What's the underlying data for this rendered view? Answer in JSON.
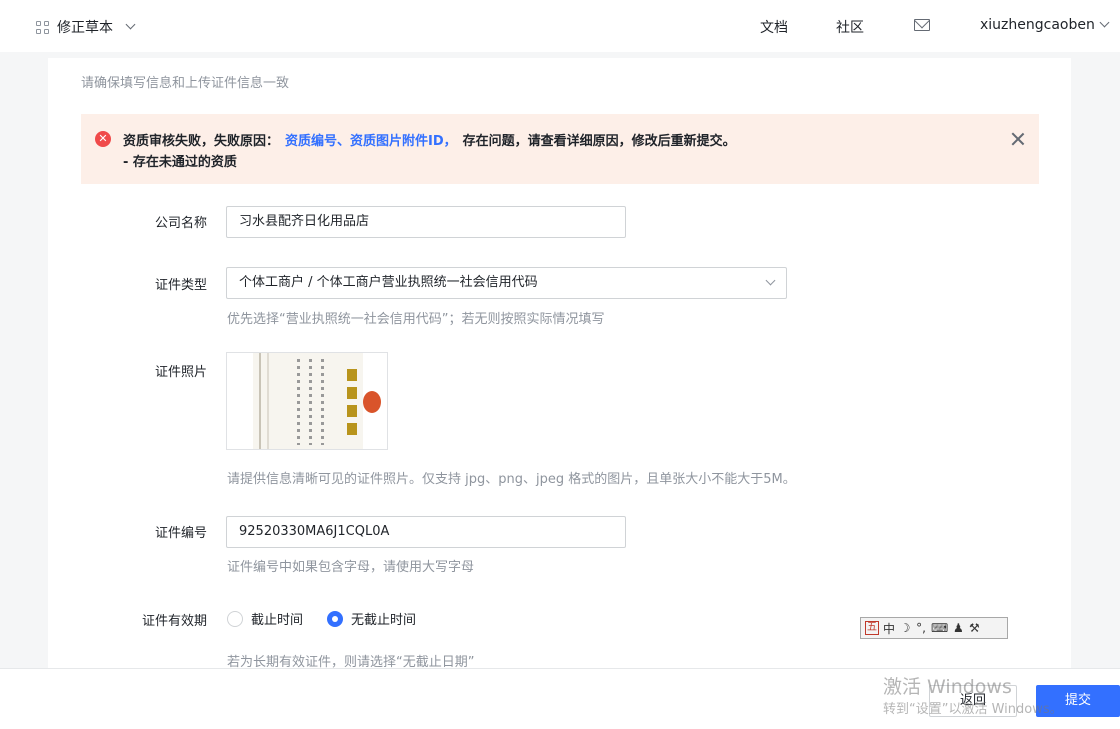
{
  "header": {
    "app_title": "修正草本",
    "nav_docs": "文档",
    "nav_community": "社区",
    "username": "xiuzhengcaoben"
  },
  "form": {
    "top_hint": "请确保填写信息和上传证件信息一致",
    "alert": {
      "prefix": "资质审核失败，失败原因：",
      "links": "资质编号、资质图片附件ID，",
      "suffix": "存在问题，请查看详细原因，修改后重新提交。",
      "detail": "- 存在未通过的资质",
      "status_color": "#f04a4a"
    },
    "company_name": {
      "label": "公司名称",
      "value": "习水县配齐日化用品店"
    },
    "cert_type": {
      "label": "证件类型",
      "value": "个体工商户 / 个体工商户营业执照统一社会信用代码",
      "help": "优先选择“营业执照统一社会信用代码”；若无则按照实际情况填写"
    },
    "cert_photo": {
      "label": "证件照片",
      "help": "请提供信息清晰可见的证件照片。仅支持 jpg、png、jpeg 格式的图片，且单张大小不能大于5M。"
    },
    "cert_number": {
      "label": "证件编号",
      "value": "92520330MA6J1CQL0A",
      "help": "证件编号中如果包含字母，请使用大写字母"
    },
    "validity": {
      "label": "证件有效期",
      "option_end": "截止时间",
      "option_no_end": "无截止时间",
      "selected": "option_no_end",
      "help": "若为长期有效证件，则请选择“无截止日期”"
    }
  },
  "ime_bar": {
    "logo": "五",
    "lang": "中",
    "moon": "☽",
    "punct": "°,",
    "keyboard": "⌨",
    "user": "♟",
    "tools": "⚒"
  },
  "actions": {
    "back": "返回",
    "submit": "提交",
    "accent_color": "#3370ff"
  },
  "watermark": {
    "line1": "激活 Windows",
    "line2": "转到“设置”以激活 Windows。"
  }
}
